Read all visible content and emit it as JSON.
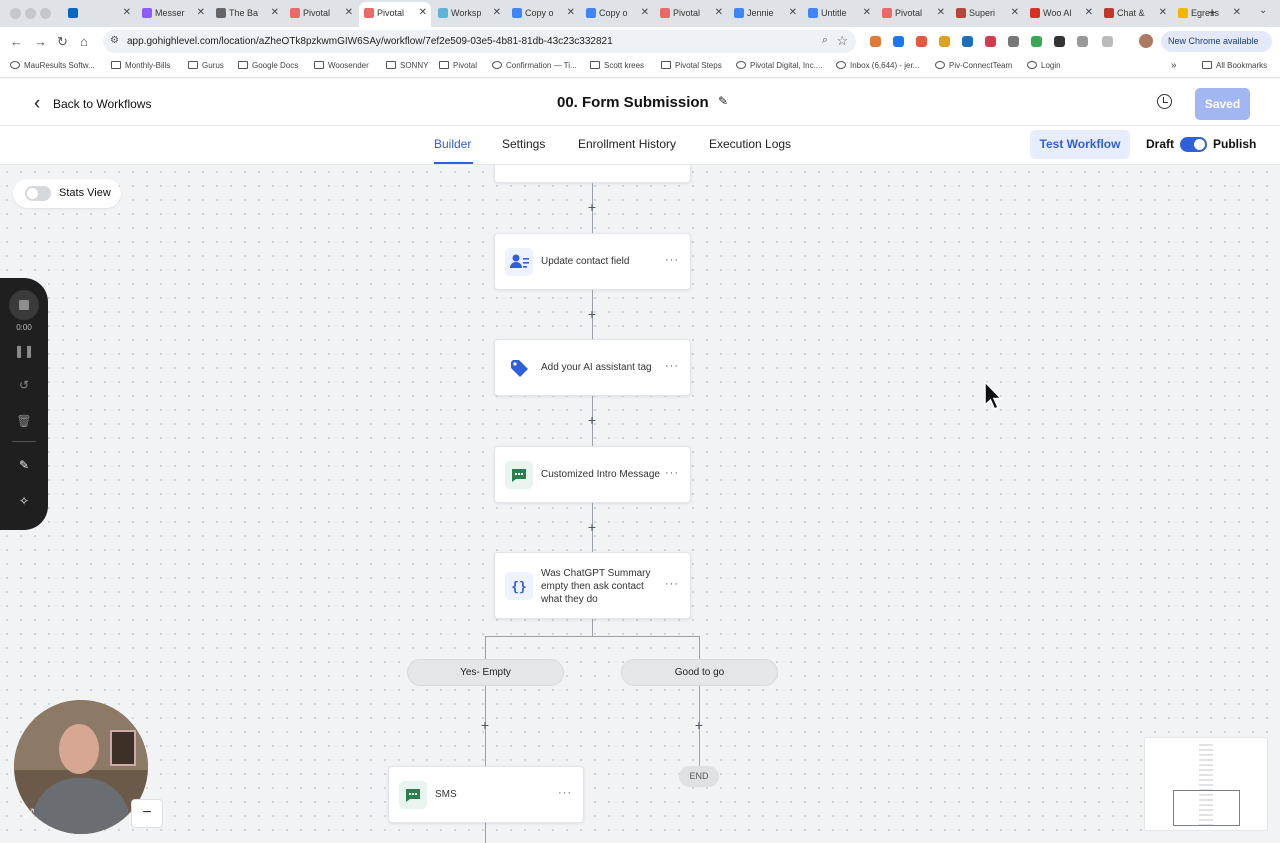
{
  "browser": {
    "tabs": [
      {
        "label": "",
        "icon_color": "#0a66c2",
        "active": false
      },
      {
        "label": "Messer",
        "icon_color": "#8b5cf6",
        "active": false
      },
      {
        "label": "The Ba",
        "icon_color": "#666666",
        "active": false
      },
      {
        "label": "Pivotal",
        "icon_color": "#e86a6a",
        "active": false
      },
      {
        "label": "Pivotal",
        "icon_color": "#e86a6a",
        "active": true
      },
      {
        "label": "Worksp",
        "icon_color": "#5fb3d9",
        "active": false
      },
      {
        "label": "Copy o",
        "icon_color": "#4285f4",
        "active": false
      },
      {
        "label": "Copy o",
        "icon_color": "#4285f4",
        "active": false
      },
      {
        "label": "Pivotal",
        "icon_color": "#e86a6a",
        "active": false
      },
      {
        "label": "Jennie",
        "icon_color": "#4285f4",
        "active": false
      },
      {
        "label": "Untitle",
        "icon_color": "#4285f4",
        "active": false
      },
      {
        "label": "Pivotal",
        "icon_color": "#e86a6a",
        "active": false
      },
      {
        "label": "Superi",
        "icon_color": "#b5473a",
        "active": false
      },
      {
        "label": "Woo Al",
        "icon_color": "#d93025",
        "active": false
      },
      {
        "label": "Chat &",
        "icon_color": "#c0392b",
        "active": false
      },
      {
        "label": "Egress",
        "icon_color": "#f2b705",
        "active": false
      }
    ],
    "close_glyph": "✕",
    "new_tab_glyph": "+",
    "url": "app.gohighlevel.com/location/aZheOTk8pzkwmGIW6SAy/workflow/7ef2e509-03e5-4b81-81db-43c23c332821",
    "new_chrome_label": "New Chrome available",
    "bookmarks": [
      {
        "label": "MauResults Softw...",
        "icon": "globe"
      },
      {
        "label": "Monthly-Bills",
        "icon": "folder"
      },
      {
        "label": "Gurus",
        "icon": "folder"
      },
      {
        "label": "Google Docs",
        "icon": "folder"
      },
      {
        "label": "Woosender",
        "icon": "folder"
      },
      {
        "label": "SONNY",
        "icon": "folder"
      },
      {
        "label": "Pivotal",
        "icon": "folder"
      },
      {
        "label": "Confirmation — Ti...",
        "icon": "globe"
      },
      {
        "label": "Scott krees",
        "icon": "folder"
      },
      {
        "label": "Pivotal Steps",
        "icon": "folder"
      },
      {
        "label": "Pivotal Digital, Inc....",
        "icon": "globe"
      },
      {
        "label": "Inbox (6,644) - jer...",
        "icon": "mail"
      },
      {
        "label": "Piv-ConnectTeam",
        "icon": "link"
      },
      {
        "label": "Login",
        "icon": "globe"
      }
    ],
    "bookmarks_more": "»",
    "all_bookmarks": "All Bookmarks"
  },
  "header": {
    "back_label": "Back to Workflows",
    "title": "00. Form Submission",
    "saved_label": "Saved"
  },
  "subnav": {
    "tabs": [
      "Builder",
      "Settings",
      "Enrollment History",
      "Execution Logs"
    ],
    "active_tab": "Builder",
    "test_workflow_label": "Test Workflow",
    "draft_label": "Draft",
    "publish_label": "Publish",
    "publish_on": true
  },
  "canvas": {
    "stats_view_label": "Stats View",
    "stats_view_on": false,
    "add_step_glyph": "+",
    "more_glyph": "···",
    "nodes": [
      {
        "label": "Update contact field",
        "icon": "contact-edit-icon"
      },
      {
        "label": "Add your AI assistant tag",
        "icon": "tag-icon"
      },
      {
        "label": "Customized Intro Message",
        "icon": "sms-icon"
      },
      {
        "label": "Was ChatGPT Summary empty then ask contact what they do",
        "icon": "code-braces-icon"
      }
    ],
    "branches": [
      "Yes- Empty",
      "Good to go"
    ],
    "sms_node_label": "SMS",
    "end_label": "END"
  },
  "recorder": {
    "time": "0:00"
  },
  "colors": {
    "accent": "#2f5fd9",
    "saved_button": "#a2b6f2",
    "sms_green": "#2e7d4f"
  }
}
